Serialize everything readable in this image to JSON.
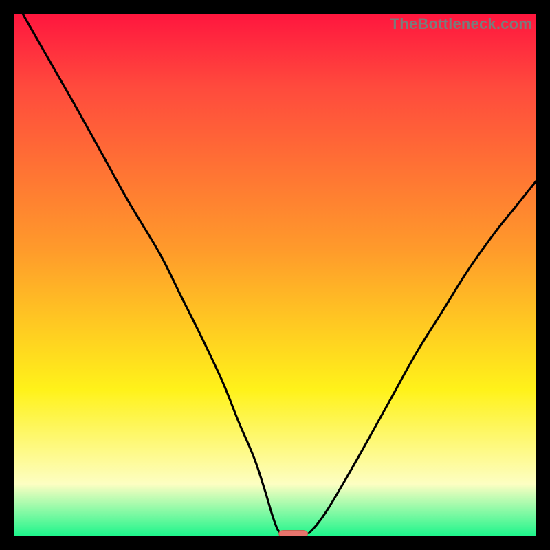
{
  "watermark": "TheBottleneck.com",
  "colors": {
    "gradient_top": "#ff163e",
    "gradient_mid_red": "#ff4a3d",
    "gradient_orange": "#ff9a2b",
    "gradient_yellow": "#fff21a",
    "gradient_pale": "#fdfec2",
    "gradient_green": "#1cf58b",
    "curve": "#000000",
    "marker_fill": "#e8746d",
    "marker_stroke": "#d44f48",
    "frame_bg": "#000000"
  },
  "chart_data": {
    "type": "line",
    "title": "",
    "xlabel": "",
    "ylabel": "",
    "xlim": [
      0,
      100
    ],
    "ylim": [
      0,
      100
    ],
    "curve_segments": [
      {
        "name": "left_branch",
        "points": [
          [
            0,
            103
          ],
          [
            4,
            96
          ],
          [
            8,
            89
          ],
          [
            12,
            82
          ],
          [
            17,
            73
          ],
          [
            22,
            64
          ],
          [
            28,
            54
          ],
          [
            32,
            46
          ],
          [
            36,
            38
          ],
          [
            40,
            29.5
          ],
          [
            43,
            22
          ],
          [
            46,
            15
          ],
          [
            48,
            9
          ],
          [
            49.5,
            4
          ],
          [
            50.5,
            1.3
          ],
          [
            51.2,
            0.6
          ]
        ]
      },
      {
        "name": "right_branch",
        "points": [
          [
            56.5,
            0.6
          ],
          [
            58,
            2.2
          ],
          [
            60,
            5
          ],
          [
            63,
            10
          ],
          [
            67,
            17
          ],
          [
            72,
            26
          ],
          [
            77,
            35
          ],
          [
            82,
            43
          ],
          [
            87,
            51
          ],
          [
            92,
            58
          ],
          [
            96,
            63
          ],
          [
            100,
            68
          ]
        ]
      }
    ],
    "marker": {
      "x_center": 53.5,
      "y": 0.5,
      "width": 5.5,
      "height": 1.2
    }
  }
}
